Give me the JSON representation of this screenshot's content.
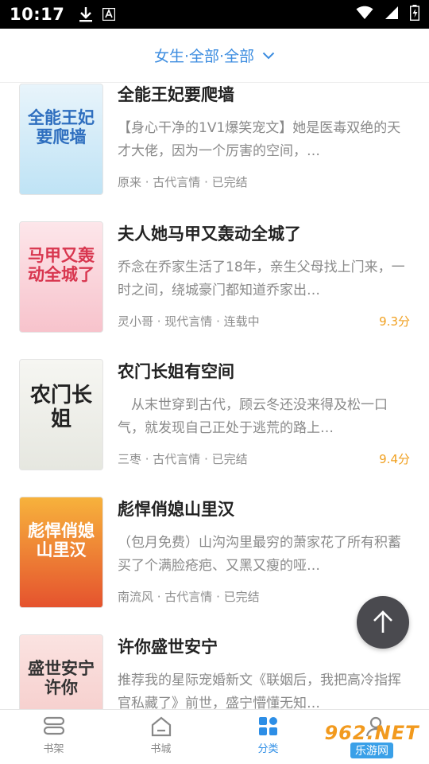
{
  "status_bar": {
    "time": "10:17"
  },
  "filter": {
    "label": "女生·全部·全部"
  },
  "books": [
    {
      "title": "全能王妃要爬墙",
      "desc": "【身心干净的1V1爆笑宠文】她是医毒双绝的天才大佬，因为一个厉害的空间，…",
      "meta": "原来 · 古代言情 · 已完结",
      "score": "",
      "cover_text": "全能王妃要爬墙",
      "cover_colors": [
        "#e8f4fb",
        "#bfe3f5"
      ],
      "cover_text_color": "#2f6fbf"
    },
    {
      "title": "夫人她马甲又轰动全城了",
      "desc": "乔念在乔家生活了18年，亲生父母找上门来，一时之间，绕城豪门都知道乔家出…",
      "meta": "灵小哥 · 现代言情 · 连载中",
      "score": "9.3分",
      "cover_text": "马甲又轰动全城了",
      "cover_colors": [
        "#fde6ea",
        "#f7c3cc"
      ],
      "cover_text_color": "#d8364f"
    },
    {
      "title": "农门长姐有空间",
      "desc": "　从末世穿到古代，顾云冬还没来得及松一口气，就发现自己正处于逃荒的路上…",
      "meta": "三枣 · 古代言情 · 已完结",
      "score": "9.4分",
      "cover_text": "农门长姐",
      "cover_colors": [
        "#f6f6f2",
        "#e6e7e0"
      ],
      "cover_text_color": "#222222"
    },
    {
      "title": "彪悍俏媳山里汉",
      "desc": "（包月免费）山沟沟里最穷的萧家花了所有积蓄买了个满脸疮疤、又黑又瘦的哑…",
      "meta": "南流风 · 古代言情 · 已完结",
      "score": "",
      "cover_text": "彪悍俏媳山里汉",
      "cover_colors": [
        "#f7b23c",
        "#e5532e"
      ],
      "cover_text_color": "#ffffff"
    },
    {
      "title": "许你盛世安宁",
      "desc": "推荐我的星际宠婚新文《联姻后，我把高冷指挥官私藏了》前世，盛宁懵懂无知…",
      "meta": "",
      "score": "",
      "cover_text": "盛世安宁 许你",
      "cover_colors": [
        "#fbe3e1",
        "#f4c8c6"
      ],
      "cover_text_color": "#333333"
    }
  ],
  "nav": [
    {
      "label": "书架",
      "icon": "bookshelf-icon",
      "active": false
    },
    {
      "label": "书城",
      "icon": "bookstore-icon",
      "active": false
    },
    {
      "label": "分类",
      "icon": "category-icon",
      "active": true
    },
    {
      "label": "我的",
      "icon": "profile-icon",
      "active": false
    }
  ],
  "watermark": {
    "top": "962.NET",
    "bottom": "乐游网"
  },
  "colors": {
    "accent": "#2d8ee6",
    "score": "#f0a020",
    "filter": "#3d8de0"
  }
}
